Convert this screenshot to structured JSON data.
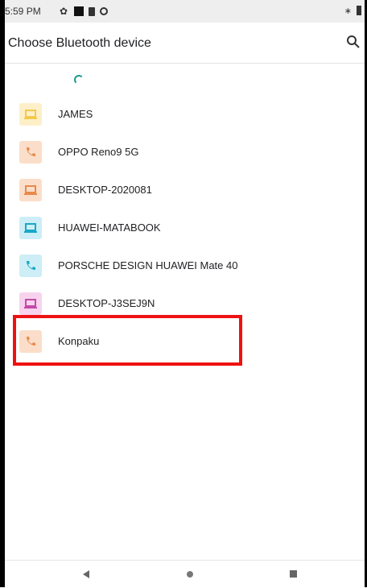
{
  "status_bar": {
    "time": "5:59 PM",
    "right": "∗"
  },
  "app_bar": {
    "title": "Choose Bluetooth device"
  },
  "devices": [
    {
      "label": "JAMES",
      "type": "laptop-icon",
      "color": "#f6c84c",
      "bg": "#fdf0c9"
    },
    {
      "label": "OPPO Reno9 5G",
      "type": "phone-icon",
      "color": "#e8894a",
      "bg": "#fbdec9"
    },
    {
      "label": "DESKTOP-2020081",
      "type": "laptop-icon",
      "color": "#e8894a",
      "bg": "#fbdec9"
    },
    {
      "label": "HUAWEI-MATABOOK",
      "type": "laptop-icon",
      "color": "#1aa7c8",
      "bg": "#cdeef6"
    },
    {
      "label": "PORSCHE DESIGN HUAWEI Mate 40",
      "type": "phone-icon",
      "color": "#1aa7c8",
      "bg": "#cdeef6"
    },
    {
      "label": "DESKTOP-J3SEJ9N",
      "type": "laptop-icon",
      "color": "#c44aa8",
      "bg": "#f7d3ee"
    },
    {
      "label": "Konpaku",
      "type": "phone-icon",
      "color": "#e8894a",
      "bg": "#fbdec9"
    }
  ],
  "highlight_color": "#ee1111"
}
